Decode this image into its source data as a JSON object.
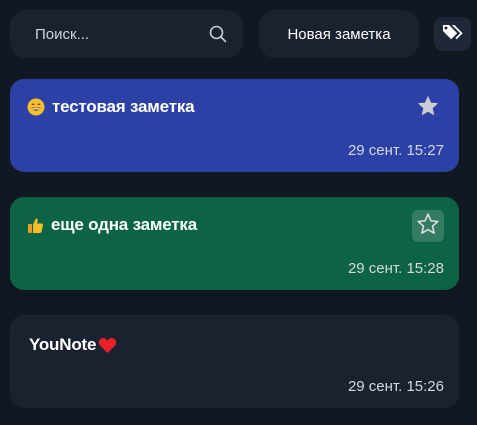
{
  "search": {
    "placeholder": "Поиск...",
    "icon": "search-icon"
  },
  "toolbar": {
    "new_note_label": "Новая заметка",
    "tags_icon": "tags-icon"
  },
  "notes": [
    {
      "emoji": "grinning-face",
      "title": "тестовая заметка",
      "date": "29 сент. 15:27",
      "starred": true,
      "color": "#2c41a5"
    },
    {
      "emoji": "thumbs-up",
      "title": "еще одна заметка",
      "date": "29 сент. 15:28",
      "starred": false,
      "color": "#0d6444"
    },
    {
      "emoji": "red-heart",
      "title": "YouNote",
      "date": "29 сент. 15:26",
      "starred": null,
      "color": "#1b222f"
    }
  ],
  "colors": {
    "background": "#121822",
    "surface": "#1b222f"
  }
}
